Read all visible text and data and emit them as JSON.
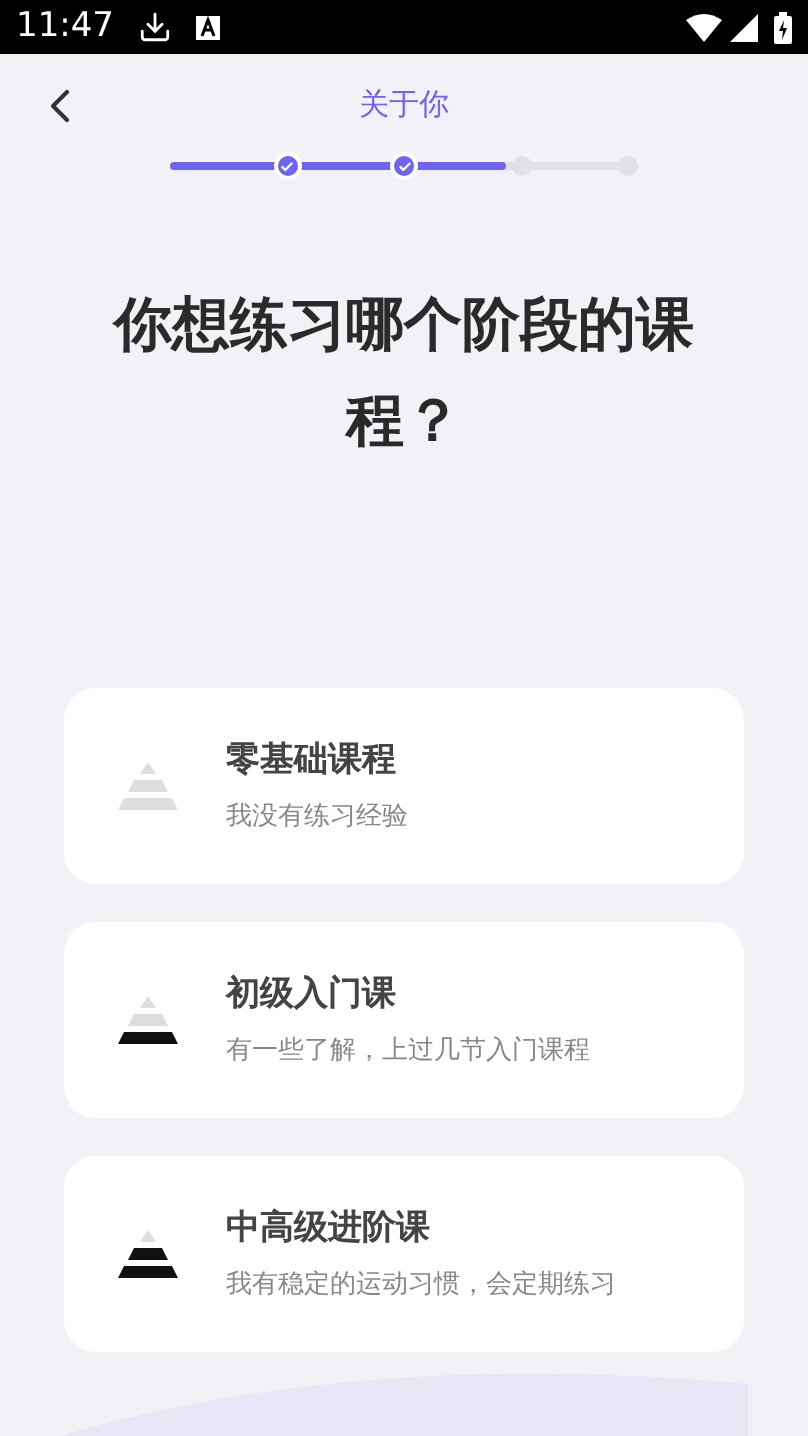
{
  "status_bar": {
    "time": "11:47"
  },
  "header": {
    "title": "关于你"
  },
  "progress": {
    "level": 0.72,
    "steps": [
      {
        "done": true
      },
      {
        "done": true
      },
      {
        "done": false
      },
      {
        "done": false
      }
    ]
  },
  "question": "你想练习哪个阶段的课程？",
  "options": [
    {
      "kind": "beginner",
      "title": "零基础课程",
      "subtitle": "我没有练习经验"
    },
    {
      "kind": "elementary",
      "title": "初级入门课",
      "subtitle": "有一些了解，上过几节入门课程"
    },
    {
      "kind": "advanced",
      "title": "中高级进阶课",
      "subtitle": "我有稳定的运动习惯，会定期练习"
    }
  ]
}
